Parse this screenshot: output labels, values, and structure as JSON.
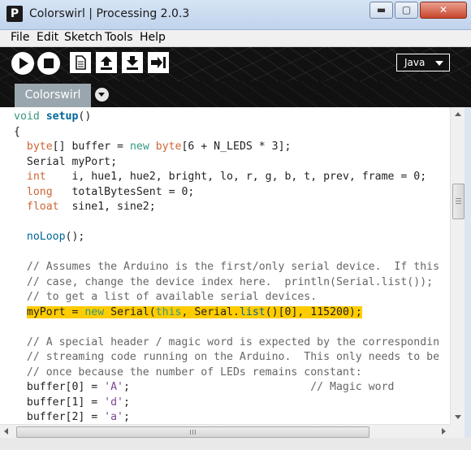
{
  "window": {
    "app_icon": "P",
    "title": "Colorswirl | Processing 2.0.3",
    "minimize_icon": "minimize-icon",
    "maximize_icon": "maximize-icon",
    "close_icon": "close-icon"
  },
  "menu": {
    "items": [
      "File",
      "Edit",
      "Sketch",
      "Tools",
      "Help"
    ]
  },
  "toolbar": {
    "buttons": [
      "run-icon",
      "stop-icon",
      "new-icon",
      "open-icon",
      "save-icon",
      "export-icon"
    ],
    "mode": "Java"
  },
  "tabs": {
    "active": "Colorswirl",
    "menu_icon": "tab-menu-arrow-icon"
  },
  "editor": {
    "lines": [
      {
        "t": "line",
        "segs": [
          {
            "c": "kw2",
            "v": "void"
          },
          {
            "c": "",
            "v": " "
          },
          {
            "c": "fn bold",
            "v": "setup"
          },
          {
            "c": "",
            "v": "()"
          }
        ]
      },
      {
        "t": "line",
        "segs": [
          {
            "c": "",
            "v": "{"
          }
        ]
      },
      {
        "t": "line",
        "segs": [
          {
            "c": "",
            "v": "  "
          },
          {
            "c": "kw",
            "v": "byte"
          },
          {
            "c": "",
            "v": "[] buffer = "
          },
          {
            "c": "kw2",
            "v": "new"
          },
          {
            "c": "",
            "v": " "
          },
          {
            "c": "kw",
            "v": "byte"
          },
          {
            "c": "",
            "v": "[6 + N_LEDS * 3];"
          }
        ]
      },
      {
        "t": "line",
        "segs": [
          {
            "c": "",
            "v": "  Serial myPort;"
          }
        ]
      },
      {
        "t": "line",
        "segs": [
          {
            "c": "",
            "v": "  "
          },
          {
            "c": "kw",
            "v": "int"
          },
          {
            "c": "",
            "v": "    i, hue1, hue2, bright, lo, r, g, b, t, prev, frame = 0;"
          }
        ]
      },
      {
        "t": "line",
        "segs": [
          {
            "c": "",
            "v": "  "
          },
          {
            "c": "kw",
            "v": "long"
          },
          {
            "c": "",
            "v": "   totalBytesSent = 0;"
          }
        ]
      },
      {
        "t": "line",
        "segs": [
          {
            "c": "",
            "v": "  "
          },
          {
            "c": "kw",
            "v": "float"
          },
          {
            "c": "",
            "v": "  sine1, sine2;"
          }
        ]
      },
      {
        "t": "line",
        "segs": [
          {
            "c": "",
            "v": ""
          }
        ]
      },
      {
        "t": "line",
        "segs": [
          {
            "c": "",
            "v": "  "
          },
          {
            "c": "fn",
            "v": "noLoop"
          },
          {
            "c": "",
            "v": "();"
          }
        ]
      },
      {
        "t": "line",
        "segs": [
          {
            "c": "",
            "v": ""
          }
        ]
      },
      {
        "t": "line",
        "segs": [
          {
            "c": "cm",
            "v": "  // Assumes the Arduino is the first/only serial device.  If this"
          }
        ]
      },
      {
        "t": "line",
        "segs": [
          {
            "c": "cm",
            "v": "  // case, change the device index here.  println(Serial.list());"
          }
        ]
      },
      {
        "t": "line",
        "segs": [
          {
            "c": "cm",
            "v": "  // to get a list of available serial devices."
          }
        ]
      },
      {
        "t": "hl",
        "segs": [
          {
            "c": "",
            "v": "  "
          },
          {
            "c": "hl",
            "v": "myPort = "
          },
          {
            "c": "hl kw2",
            "v": "new"
          },
          {
            "c": "hl",
            "v": " Serial("
          },
          {
            "c": "hl kw2",
            "v": "this"
          },
          {
            "c": "hl",
            "v": ", Serial."
          },
          {
            "c": "hl fn",
            "v": "list"
          },
          {
            "c": "hl",
            "v": "()[0], 115200);"
          }
        ]
      },
      {
        "t": "line",
        "segs": [
          {
            "c": "",
            "v": ""
          }
        ]
      },
      {
        "t": "line",
        "segs": [
          {
            "c": "cm",
            "v": "  // A special header / magic word is expected by the correspondin"
          }
        ]
      },
      {
        "t": "line",
        "segs": [
          {
            "c": "cm",
            "v": "  // streaming code running on the Arduino.  This only needs to be"
          }
        ]
      },
      {
        "t": "line",
        "segs": [
          {
            "c": "cm",
            "v": "  // once because the number of LEDs remains constant:"
          }
        ]
      },
      {
        "t": "line",
        "segs": [
          {
            "c": "",
            "v": "  buffer[0] = "
          },
          {
            "c": "str",
            "v": "'A'"
          },
          {
            "c": "",
            "v": ";                            "
          },
          {
            "c": "cm",
            "v": "// Magic word"
          }
        ]
      },
      {
        "t": "line",
        "segs": [
          {
            "c": "",
            "v": "  buffer[1] = "
          },
          {
            "c": "str",
            "v": "'d'"
          },
          {
            "c": "",
            "v": ";"
          }
        ]
      },
      {
        "t": "line",
        "segs": [
          {
            "c": "",
            "v": "  buffer[2] = "
          },
          {
            "c": "str",
            "v": "'a'"
          },
          {
            "c": "",
            "v": ";"
          }
        ]
      }
    ]
  },
  "scrollbars": {
    "vertical_position": 0.2,
    "horizontal_position": 0.0
  }
}
